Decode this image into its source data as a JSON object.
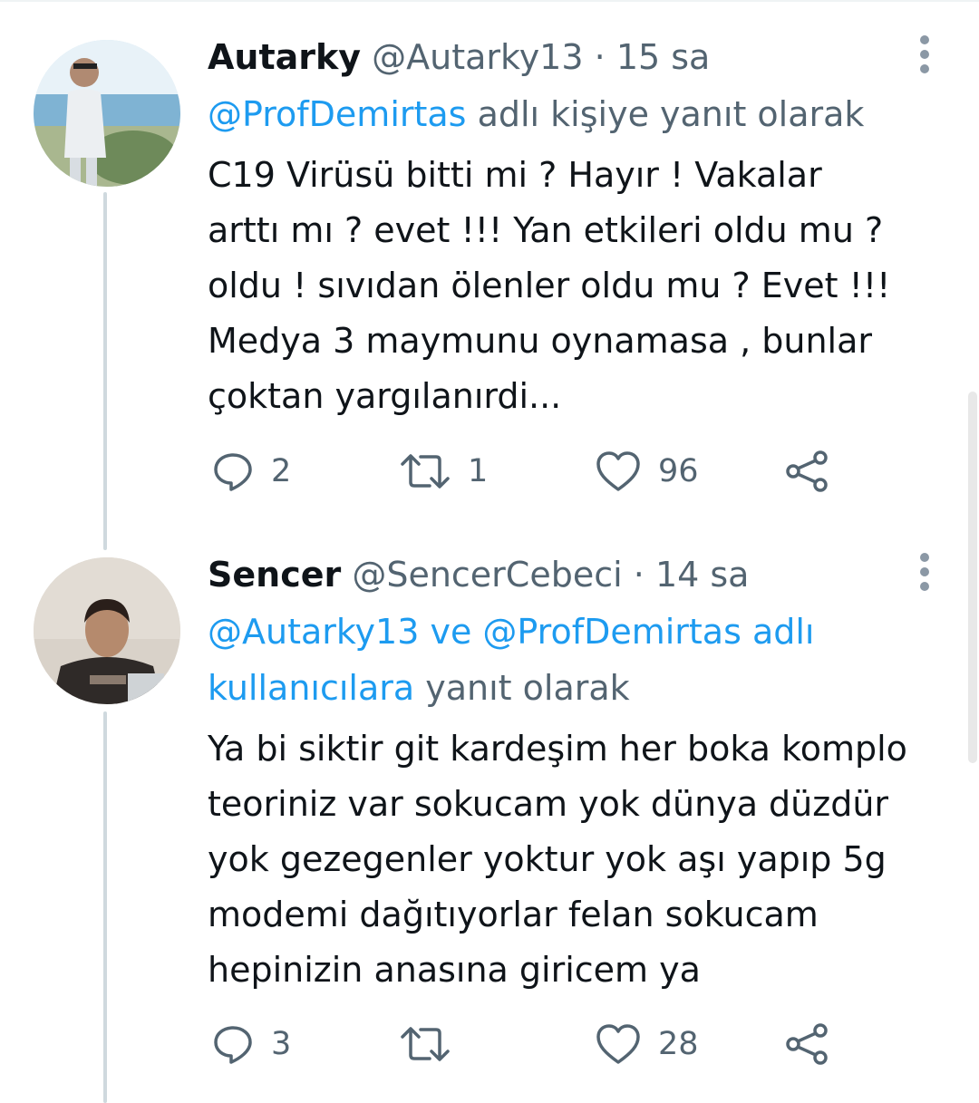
{
  "colors": {
    "accent": "#1d9bf0",
    "secondary_text": "#536471",
    "primary_text": "#0f1419",
    "thread_line": "#cfd9de"
  },
  "tweets": [
    {
      "name": "Autarky",
      "handle": "@Autarky13",
      "separator": "·",
      "time": "15 sa",
      "avatar_icon": "user-avatar-photo",
      "reply_mention": "@ProfDemirtas",
      "reply_suffix": " adlı kişiye yanıt olarak",
      "text": "C19 Virüsü bitti mi ?  Hayır  ! Vakalar\narttı mı ?  evet !!! Yan etkileri oldu mu ?\noldu !  sıvıdan ölenler oldu mu ?  Evet !!!\nMedya 3 maymunu  oynamasa ,  bunlar\nçoktan yargılanırdi...",
      "replies": "2",
      "retweets": "1",
      "likes": "96"
    },
    {
      "name": "Sencer",
      "handle": "@SencerCebeci",
      "separator": "·",
      "time": "14 sa",
      "avatar_icon": "user-avatar-photo",
      "reply_mention": "@Autarky13 ve @ProfDemirtas adlı kullanıcılara",
      "reply_suffix": " yanıt olarak",
      "text": "Ya bi siktir git kardeşim her boka komplo\nteoriniz var sokucam yok dünya düzdür\nyok gezegenler yoktur yok aşı yapıp 5g\nmodemi dağıtıyorlar felan sokucam\nhepinizin anasına giricem ya",
      "replies": "3",
      "retweets": "",
      "likes": "28"
    }
  ],
  "icons": {
    "reply": "reply-icon",
    "retweet": "retweet-icon",
    "like": "heart-icon",
    "share": "share-icon",
    "more": "more-vertical-icon"
  }
}
